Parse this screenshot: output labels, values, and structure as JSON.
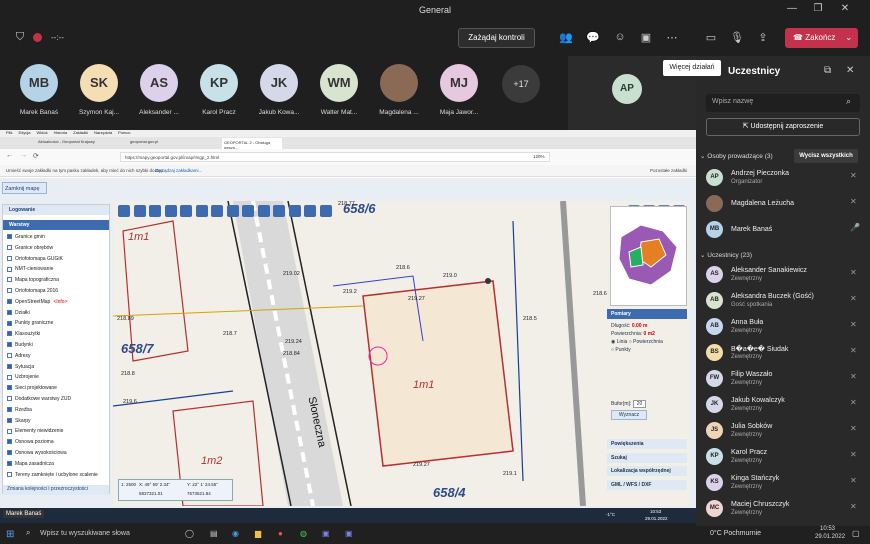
{
  "window": {
    "title": "General"
  },
  "toolbar": {
    "request_control": "Zażądaj kontroli",
    "end_call": "Zakończ",
    "timer": "--:--"
  },
  "tooltip": "Więcej działań",
  "participants_strip": [
    {
      "initials": "MB",
      "name": "Marek Banaś",
      "color": "#b4d3e6"
    },
    {
      "initials": "SK",
      "name": "Szymon Kaj...",
      "color": "#f5deb3"
    },
    {
      "initials": "AS",
      "name": "Aleksander ...",
      "color": "#dcd0ea"
    },
    {
      "initials": "KP",
      "name": "Karol Pracz",
      "color": "#c8e0e8"
    },
    {
      "initials": "JK",
      "name": "Jakub Kowa...",
      "color": "#d4d8e8"
    },
    {
      "initials": "WM",
      "name": "Walter Mat...",
      "color": "#d8e4cf"
    },
    {
      "initials": "",
      "name": "Magdalena ...",
      "color": "#8a6a55"
    },
    {
      "initials": "MJ",
      "name": "Maja Jawor...",
      "color": "#e6c8df"
    }
  ],
  "more_count": "+17",
  "ap_tile": "AP",
  "panel": {
    "title": "Uczestnicy",
    "search_placeholder": "Wpisz nazwę",
    "share_invite": "Udostępnij zaproszenie",
    "organizers_header": "Osoby prowadzące (3)",
    "mute_all": "Wycisz wszystkich",
    "organizers": [
      {
        "initials": "AP",
        "name": "Andrzej Pieczonka",
        "role": "Organizator",
        "color": "#c8e0d0"
      },
      {
        "initials": "",
        "name": "Magdalena Leżucha",
        "role": "",
        "color": "#8a6a55"
      },
      {
        "initials": "MB",
        "name": "Marek Banaś",
        "role": "",
        "color": "#b4d3e6"
      }
    ],
    "attendees_header": "Uczestnicy (23)",
    "attendees": [
      {
        "initials": "AS",
        "name": "Aleksander Sanakiewicz",
        "role": "Zewnętrzny",
        "color": "#dcd0ea"
      },
      {
        "initials": "AB",
        "name": "Aleksandra Buczek (Gość)",
        "role": "Gość spotkania",
        "color": "#d8e4cf"
      },
      {
        "initials": "AB",
        "name": "Anna Buła",
        "role": "Zewnętrzny",
        "color": "#c8d8ec"
      },
      {
        "initials": "BS",
        "name": "B�a�e� Siudak",
        "role": "Zewnętrzny",
        "color": "#f2dca8"
      },
      {
        "initials": "FW",
        "name": "Filip Waszało",
        "role": "Zewnętrzny",
        "color": "#d4d8e8"
      },
      {
        "initials": "JK",
        "name": "Jakub Kowalczyk",
        "role": "Zewnętrzny",
        "color": "#d4d8e8"
      },
      {
        "initials": "JS",
        "name": "Julia Sobków",
        "role": "Zewnętrzny",
        "color": "#f0d4b8"
      },
      {
        "initials": "KP",
        "name": "Karol Pracz",
        "role": "Zewnętrzny",
        "color": "#c8e0e8"
      },
      {
        "initials": "KS",
        "name": "Kinga Stańczyk",
        "role": "Zewnętrzny",
        "color": "#dcd0ea"
      },
      {
        "initials": "MC",
        "name": "Maciej Chruszczyk",
        "role": "Zewnętrzny",
        "color": "#f0d4d4"
      }
    ]
  },
  "browser": {
    "menu": [
      "Plik",
      "Edycja",
      "Widok",
      "Historia",
      "Zakładki",
      "Narzędzia",
      "Pomoc"
    ],
    "tabs": [
      "Aktualności - Geoportal Krajowy",
      "geoportal.gov.pl",
      "GEOPORTAL 2 - Obsługa wyszu..."
    ],
    "url": "https://mapy.geoportal.gov.pl/imap/Imgp_2.html",
    "zoom": "120%",
    "bookmarks_note": "Umieść swoje zakładki na tym pasku zakładek, aby mieć do nich szybki dostęp.",
    "bookmarks_link": "Zarządzaj zakładkami...",
    "other_bookmarks": "Pozostałe zakładki",
    "close_map": "Zamknij mapę",
    "login": "Logowanie",
    "layers_header": "Warstwy",
    "layers": [
      {
        "label": "Granice gmin",
        "on": true
      },
      {
        "label": "Granice obrębów",
        "on": false
      },
      {
        "label": "Ortofotomapa GUGiK",
        "on": false
      },
      {
        "label": "NMT-cieniowanie",
        "on": false
      },
      {
        "label": "Mapa topograficzna",
        "on": false
      },
      {
        "label": "Ortofotomapa 2016",
        "on": false
      },
      {
        "label": "OpenStreetMap",
        "on": true
      },
      {
        "label": "Działki",
        "on": true
      },
      {
        "label": "Punkty graniczne",
        "on": true
      },
      {
        "label": "Klasoużytki",
        "on": true
      },
      {
        "label": "Budynki",
        "on": true
      },
      {
        "label": "Adresy",
        "on": false
      },
      {
        "label": "Sytuacja",
        "on": true
      },
      {
        "label": "Uzbrojenie",
        "on": false
      },
      {
        "label": "Sieci projektowane",
        "on": true
      },
      {
        "label": "Dodatkowe warstwy ZUD",
        "on": false
      },
      {
        "label": "Rzeźba",
        "on": true
      },
      {
        "label": "Skarpy",
        "on": true
      },
      {
        "label": "Elementy niewidzenie",
        "on": false
      },
      {
        "label": "Osnowa pozioma",
        "on": true
      },
      {
        "label": "Osnowa wysokościowa",
        "on": true
      },
      {
        "label": "Mapa zasadnicza",
        "on": true
      },
      {
        "label": "Tereny zamknięte i ucbylone scalenie",
        "on": false
      }
    ],
    "osm_info": "<Info>",
    "history_link": "Zmiana kolejności i przezroczystości",
    "parcels": [
      "658/6",
      "658/7",
      "658/4"
    ],
    "street": "Słoneczna",
    "heights": [
      "218.77",
      "218.6",
      "219.0",
      "218.89",
      "219.02",
      "219.27",
      "218.5",
      "219.2",
      "218.8",
      "219.6",
      "218.84",
      "219.24",
      "218.7",
      "219.27",
      "219.1",
      "218.6"
    ],
    "buildings": [
      "1m1",
      "1m1",
      "1m2"
    ],
    "coords": {
      "scale": "1:\n2500",
      "x_label": "X:",
      "x": "49° 59' 2.34\"",
      "x2": "5837321.01",
      "y_label": "Y:",
      "y": "22° 1' 24.55\"",
      "y2": "7673621.84"
    },
    "measure": {
      "title": "Pomiary",
      "length_label": "Długość:",
      "length": "0.00 m",
      "area_label": "Powierzchnia:",
      "area": "0 m2",
      "opt_line": "Linia",
      "opt_area": "Powierzchnia",
      "opt_points": "Punkty",
      "buffer_label": "Bufor[m]:",
      "buffer": "20",
      "button": "Wyznacz"
    },
    "right_menu": [
      "Powiększenia",
      "Szukaj",
      "Lokalizacja współrzędnej",
      "GML / WFS / DXF"
    ]
  },
  "share_taskbar": {
    "user": "Marek Banaś",
    "time": "10:53",
    "date": "29.01.2022",
    "weather": "-1°C"
  },
  "taskbar": {
    "search": "Wpisz tu wyszukiwane słowa",
    "weather": "0°C Pochmurnie",
    "time": "10:53",
    "date": "29.01.2022"
  }
}
